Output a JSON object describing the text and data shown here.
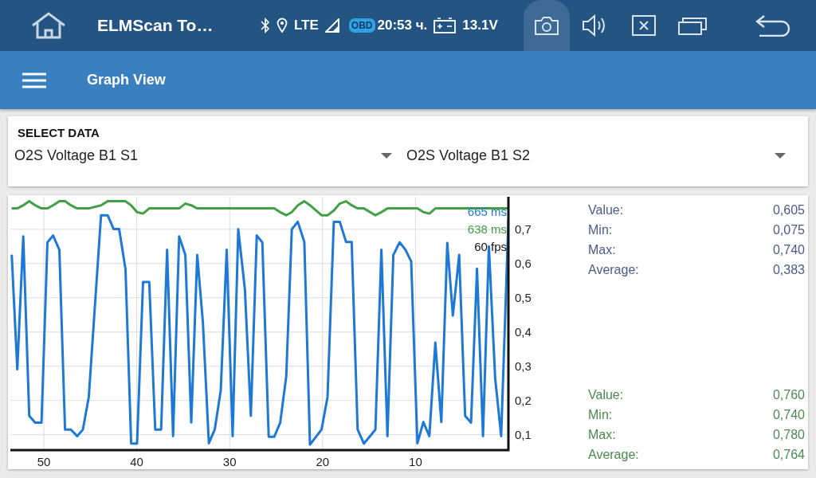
{
  "status_bar": {
    "app_title": "ELMScan To…",
    "network": "LTE",
    "obd_badge": "OBD",
    "time": "20:53 ч.",
    "voltage": "13.1V",
    "camera_selected": true
  },
  "app_bar": {
    "title": "Graph View"
  },
  "select_data": {
    "heading": "SELECT DATA",
    "dropdowns": [
      {
        "value": "O2S Voltage B1 S1"
      },
      {
        "value": "O2S Voltage B1 S2"
      }
    ]
  },
  "graph": {
    "overlay_labels": [
      {
        "text": "665 ms",
        "color": "#1e78d6"
      },
      {
        "text": "638 ms",
        "color": "#43a047"
      },
      {
        "text": "60 fps",
        "color": "#111111"
      }
    ],
    "chart_data": {
      "type": "line",
      "grid": true,
      "xlim": [
        53.6,
        0
      ],
      "ylim": [
        0.055,
        0.795
      ],
      "xticks": [
        50,
        40,
        30,
        20,
        10
      ],
      "yticks": [
        {
          "value": 0.1,
          "label": "0,1"
        },
        {
          "value": 0.2,
          "label": "0,2"
        },
        {
          "value": 0.3,
          "label": "0,3"
        },
        {
          "value": 0.4,
          "label": "0,4"
        },
        {
          "value": 0.5,
          "label": "0,5"
        },
        {
          "value": 0.6,
          "label": "0,6"
        },
        {
          "value": 0.7,
          "label": "0,7"
        }
      ],
      "x": [
        53.45,
        52.85,
        52.21,
        51.57,
        50.93,
        50.25,
        49.61,
        49.0,
        48.33,
        47.72,
        47.08,
        46.41,
        45.8,
        45.16,
        43.84,
        43.13,
        42.49,
        41.89,
        41.21,
        40.6,
        39.96,
        39.32,
        38.65,
        38.01,
        37.37,
        36.73,
        36.09,
        35.44,
        34.77,
        34.13,
        33.49,
        32.88,
        32.24,
        31.6,
        30.96,
        30.32,
        29.68,
        29.07,
        28.36,
        27.72,
        27.08,
        26.48,
        25.8,
        25.2,
        24.56,
        23.91,
        23.31,
        22.67,
        21.96,
        21.35,
        20.11,
        19.47,
        18.79,
        18.15,
        17.47,
        16.87,
        16.23,
        15.55,
        14.31,
        13.67,
        13.02,
        12.38,
        11.71,
        11.07,
        10.46,
        9.79,
        9.15,
        8.51,
        7.86,
        7.22,
        6.58,
        5.98,
        5.3,
        4.66,
        4.02,
        3.38,
        2.74,
        2.1,
        1.42,
        0.78,
        0
      ],
      "series": [
        {
          "color": "#1e78d6",
          "values": [
            0.626,
            0.291,
            0.679,
            0.155,
            0.135,
            0.135,
            0.662,
            0.682,
            0.64,
            0.115,
            0.115,
            0.096,
            0.115,
            0.21,
            0.741,
            0.741,
            0.701,
            0.701,
            0.583,
            0.074,
            0.074,
            0.546,
            0.546,
            0.115,
            0.115,
            0.64,
            0.096,
            0.679,
            0.625,
            0.136,
            0.625,
            0.429,
            0.075,
            0.115,
            0.229,
            0.64,
            0.096,
            0.7,
            0.525,
            0.155,
            0.682,
            0.662,
            0.094,
            0.094,
            0.135,
            0.27,
            0.7,
            0.722,
            0.663,
            0.071,
            0.115,
            0.21,
            0.722,
            0.722,
            0.663,
            0.663,
            0.115,
            0.074,
            0.115,
            0.64,
            0.096,
            0.625,
            0.662,
            0.64,
            0.606,
            0.075,
            0.137,
            0.096,
            0.369,
            0.137,
            0.66,
            0.448,
            0.625,
            0.155,
            0.135,
            0.585,
            0.096,
            0.65,
            0.265,
            0.096,
            0.727
          ]
        },
        {
          "color": "#43a047",
          "values": [
            0.761,
            0.761,
            0.77,
            0.782,
            0.77,
            0.761,
            0.761,
            0.77,
            0.782,
            0.782,
            0.77,
            0.761,
            0.761,
            0.761,
            0.77,
            0.782,
            0.782,
            0.782,
            0.782,
            0.77,
            0.75,
            0.746,
            0.761,
            0.761,
            0.761,
            0.761,
            0.761,
            0.761,
            0.775,
            0.77,
            0.761,
            0.761,
            0.761,
            0.761,
            0.761,
            0.761,
            0.761,
            0.761,
            0.761,
            0.761,
            0.761,
            0.761,
            0.761,
            0.761,
            0.75,
            0.741,
            0.75,
            0.77,
            0.782,
            0.77,
            0.741,
            0.741,
            0.755,
            0.775,
            0.782,
            0.77,
            0.761,
            0.761,
            0.741,
            0.75,
            0.761,
            0.761,
            0.761,
            0.761,
            0.761,
            0.761,
            0.75,
            0.746,
            0.761,
            0.761,
            0.761,
            0.761,
            0.761,
            0.761,
            0.761,
            0.761,
            0.761,
            0.761,
            0.761,
            0.761,
            0.761
          ]
        }
      ]
    }
  },
  "stats": [
    {
      "color": "#4a5a8c",
      "rows": [
        {
          "label": "Value:",
          "value": "0,605"
        },
        {
          "label": "Min:",
          "value": "0,075"
        },
        {
          "label": "Max:",
          "value": "0,740"
        },
        {
          "label": "Average:",
          "value": "0,383"
        }
      ]
    },
    {
      "color": "#4a8a4e",
      "rows": [
        {
          "label": "Value:",
          "value": "0,760"
        },
        {
          "label": "Min:",
          "value": "0,740"
        },
        {
          "label": "Max:",
          "value": "0,780"
        },
        {
          "label": "Average:",
          "value": "0,764"
        }
      ]
    }
  ]
}
